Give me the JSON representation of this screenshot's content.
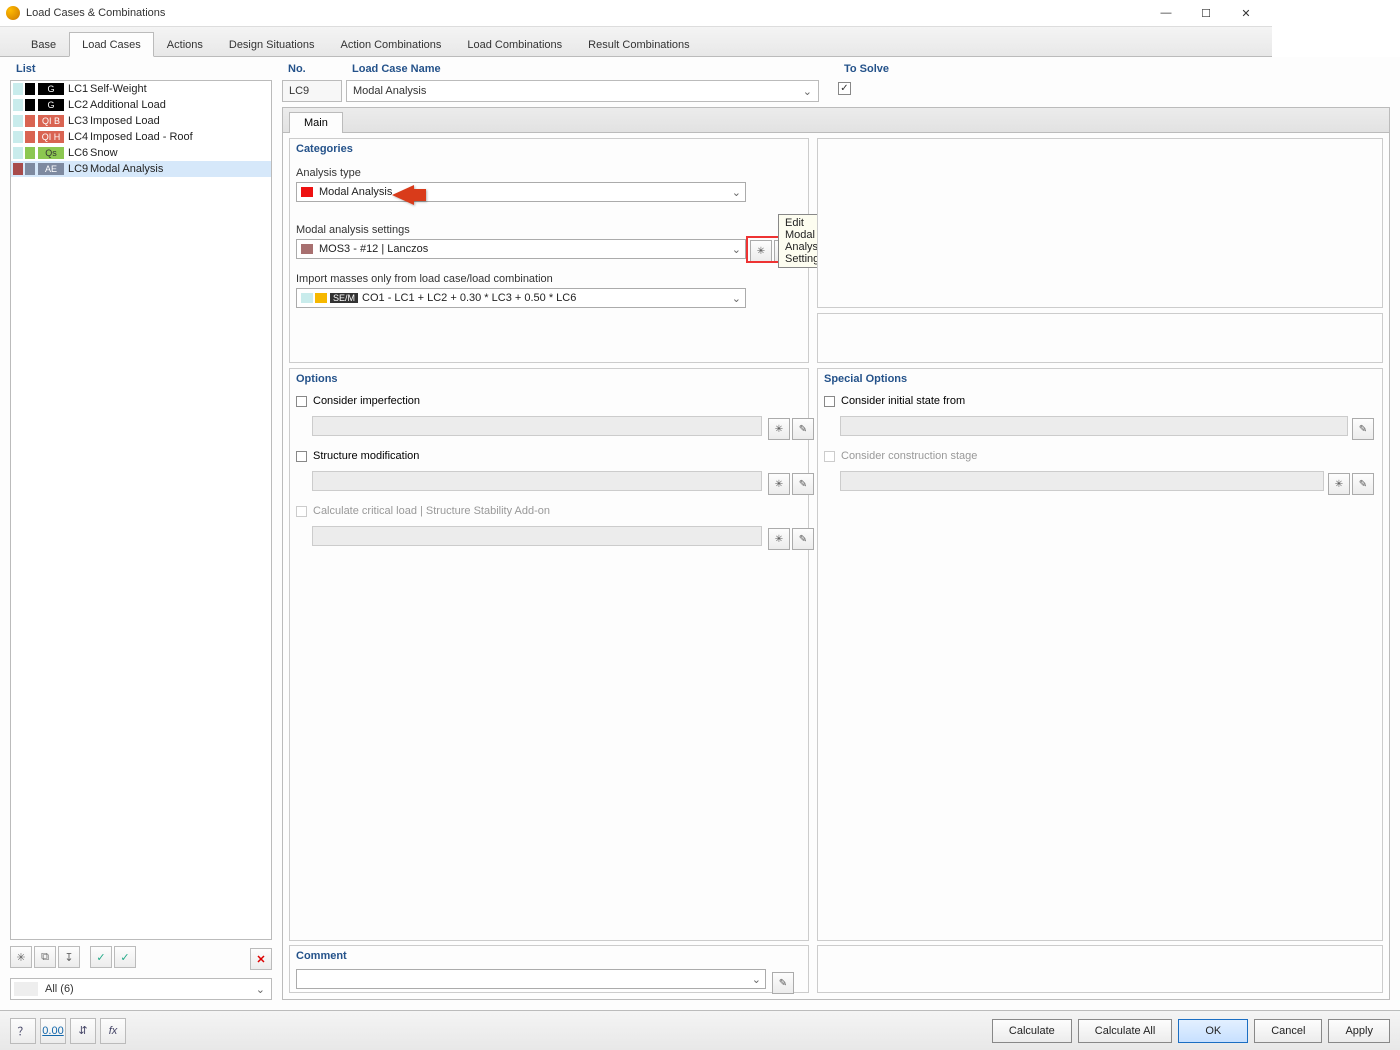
{
  "window": {
    "title": "Load Cases & Combinations"
  },
  "tabs": [
    "Base",
    "Load Cases",
    "Actions",
    "Design Situations",
    "Action Combinations",
    "Load Combinations",
    "Result Combinations"
  ],
  "active_tab": 1,
  "list": {
    "header": "List",
    "items": [
      {
        "tag": "G",
        "tag_bg": "#000000",
        "sw2": "#000000",
        "id": "LC1",
        "name": "Self-Weight"
      },
      {
        "tag": "G",
        "tag_bg": "#000000",
        "sw2": "#000000",
        "id": "LC2",
        "name": "Additional Load"
      },
      {
        "tag": "QI B",
        "tag_bg": "#d96452",
        "sw2": "#d96452",
        "id": "LC3",
        "name": "Imposed Load"
      },
      {
        "tag": "QI H",
        "tag_bg": "#d96452",
        "sw2": "#d96452",
        "id": "LC4",
        "name": "Imposed Load - Roof"
      },
      {
        "tag": "Qs",
        "tag_bg": "#8cc751",
        "sw2": "#8cc751",
        "id": "LC6",
        "name": "Snow"
      },
      {
        "tag": "AE",
        "tag_bg": "#7e8aa0",
        "sw2": "#a84b4b",
        "id": "LC9",
        "name": "Modal Analysis"
      }
    ],
    "selected": 5,
    "filter": "All (6)"
  },
  "no_header": "No.",
  "name_header": "Load Case Name",
  "solve_header": "To Solve",
  "no_value": "LC9",
  "name_value": "Modal Analysis",
  "solve_checked": true,
  "sub_tab": "Main",
  "categories": {
    "header": "Categories",
    "analysis_type_lbl": "Analysis type",
    "analysis_type_val": "Modal Analysis",
    "modal_settings_lbl": "Modal analysis settings",
    "modal_settings_val": "MOS3 - #12 | Lanczos",
    "import_lbl": "Import masses only from load case/load combination",
    "import_tag": "SE/M",
    "import_val": "CO1 - LC1 + LC2 + 0.30 * LC3 + 0.50 * LC6"
  },
  "tooltip": "Edit Modal Analysis Settings...",
  "options": {
    "header": "Options",
    "imperfection": "Consider imperfection",
    "structmod": "Structure modification",
    "critical": "Calculate critical load | Structure Stability Add-on"
  },
  "special": {
    "header": "Special Options",
    "initstate": "Consider initial state from",
    "construction": "Consider construction stage"
  },
  "comment_header": "Comment",
  "footer": {
    "calculate": "Calculate",
    "calculate_all": "Calculate All",
    "ok": "OK",
    "cancel": "Cancel",
    "apply": "Apply"
  }
}
